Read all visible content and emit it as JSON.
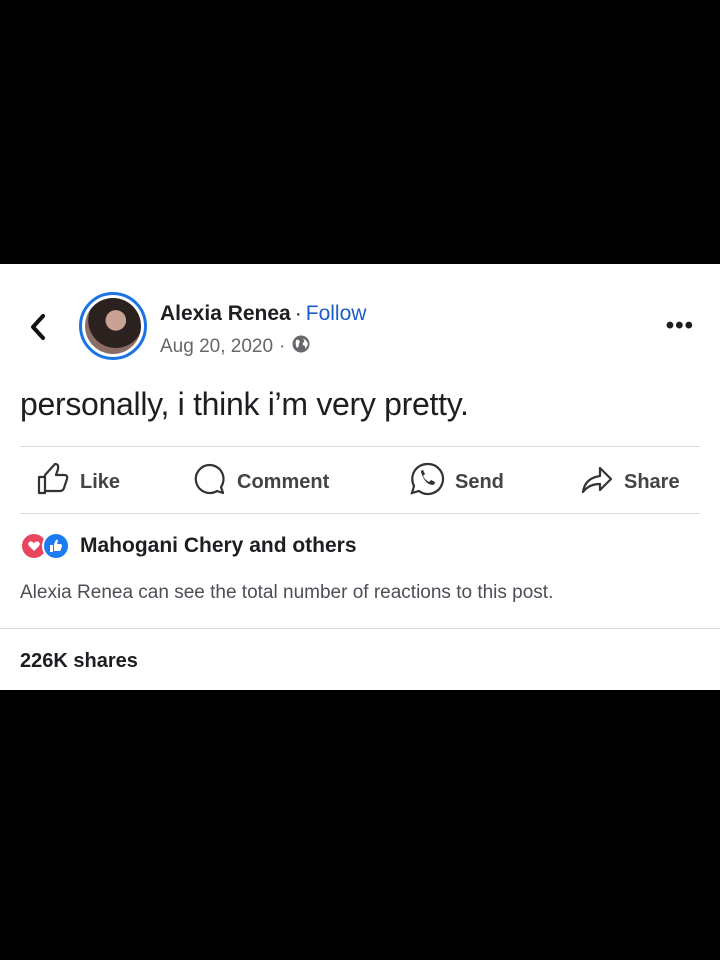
{
  "post": {
    "author_name": "Alexia Renea",
    "follow_label": "Follow",
    "date": "Aug 20, 2020",
    "text": "personally, i think i’m very pretty."
  },
  "actions": {
    "like": "Like",
    "comment": "Comment",
    "send": "Send",
    "share": "Share"
  },
  "reactions": {
    "summary": "Mahogani Chery and others",
    "notice": "Alexia Renea can see the total number of reactions to this post."
  },
  "shares": "226K shares",
  "colors": {
    "follow": "#1d5fc9",
    "avatar_ring": "#1b74e4",
    "love": "#e8465f",
    "like": "#1a7cf0"
  },
  "icons": [
    "back-arrow-icon",
    "globe-icon",
    "more-options-icon",
    "like-icon",
    "comment-icon",
    "whatsapp-send-icon",
    "share-icon",
    "love-reaction-icon",
    "like-reaction-icon"
  ]
}
